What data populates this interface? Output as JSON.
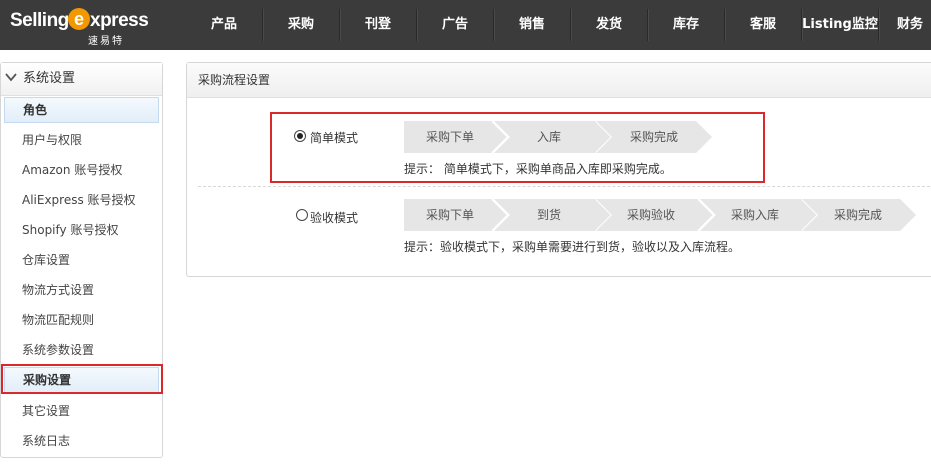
{
  "brand": {
    "name_part1": "Selling",
    "name_mark": "e",
    "name_part2": "xpress",
    "name_cn": "速易特",
    "accent": "#f39800"
  },
  "nav": {
    "items": [
      "产品",
      "采购",
      "刊登",
      "广告",
      "销售",
      "发货",
      "库存",
      "客服",
      "Listing监控",
      "财务"
    ]
  },
  "sidebar": {
    "header": "系统设置",
    "header_icon": "chevron-down-icon",
    "items": [
      "角色",
      "用户与权限",
      "Amazon 账号授权",
      "AliExpress 账号授权",
      "Shopify 账号授权",
      "仓库设置",
      "物流方式设置",
      "物流匹配规则",
      "系统参数设置",
      "采购设置",
      "其它设置",
      "系统日志"
    ]
  },
  "panel": {
    "title": "采购流程设置",
    "simple": {
      "label": "简单模式",
      "checked": true,
      "steps": [
        "采购下单",
        "入库",
        "采购完成"
      ],
      "tip": "提示：  简单模式下，采购单商品入库即采购完成。"
    },
    "inspect": {
      "label": "验收模式",
      "checked": false,
      "steps": [
        "采购下单",
        "到货",
        "采购验收",
        "采购入库",
        "采购完成"
      ],
      "tip": "提示：验收模式下，采购单需要进行到货，验收以及入库流程。"
    }
  },
  "colors": {
    "topbar": "#3b3b3b",
    "highlight": "#d9292a",
    "step_fill": "#e6e6e6"
  }
}
